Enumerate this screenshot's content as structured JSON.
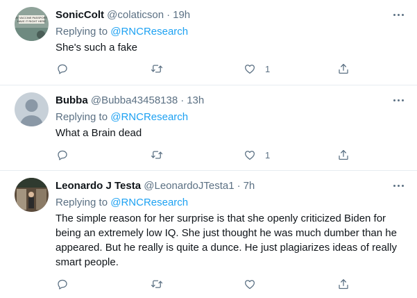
{
  "tweets": [
    {
      "name": "SonicColt",
      "handle": "@colaticson",
      "sep": "·",
      "time": "19h",
      "reply_prefix": "Replying to ",
      "reply_to": "@RNCResearch",
      "text": "She's such a fake",
      "likes": "1",
      "avatar_text": "MY VACCINE PASSPORT? HAVE IT RIGHT HERE"
    },
    {
      "name": "Bubba",
      "handle": "@Bubba43458138",
      "sep": "·",
      "time": "13h",
      "reply_prefix": "Replying to ",
      "reply_to": "@RNCResearch",
      "text": "What a Brain dead",
      "likes": "1"
    },
    {
      "name": "Leonardo J Testa",
      "handle": "@LeonardoJTesta1",
      "sep": "·",
      "time": "7h",
      "reply_prefix": "Replying to ",
      "reply_to": "@RNCResearch",
      "text": "The simple reason for her surprise is that she openly criticized Biden for being an extremely low IQ. She just thought he was much dumber than he appeared. But he really is quite a dunce. He just plagiarizes ideas of really smart people.",
      "likes": ""
    }
  ],
  "icons": {
    "reply": "reply-icon",
    "retweet": "retweet-icon",
    "like": "like-icon",
    "share": "share-icon",
    "more": "more-icon"
  },
  "colors": {
    "text": "#0f1419",
    "secondary": "#5b7083",
    "link": "#1da1f2",
    "divider": "#e6ecf0"
  }
}
